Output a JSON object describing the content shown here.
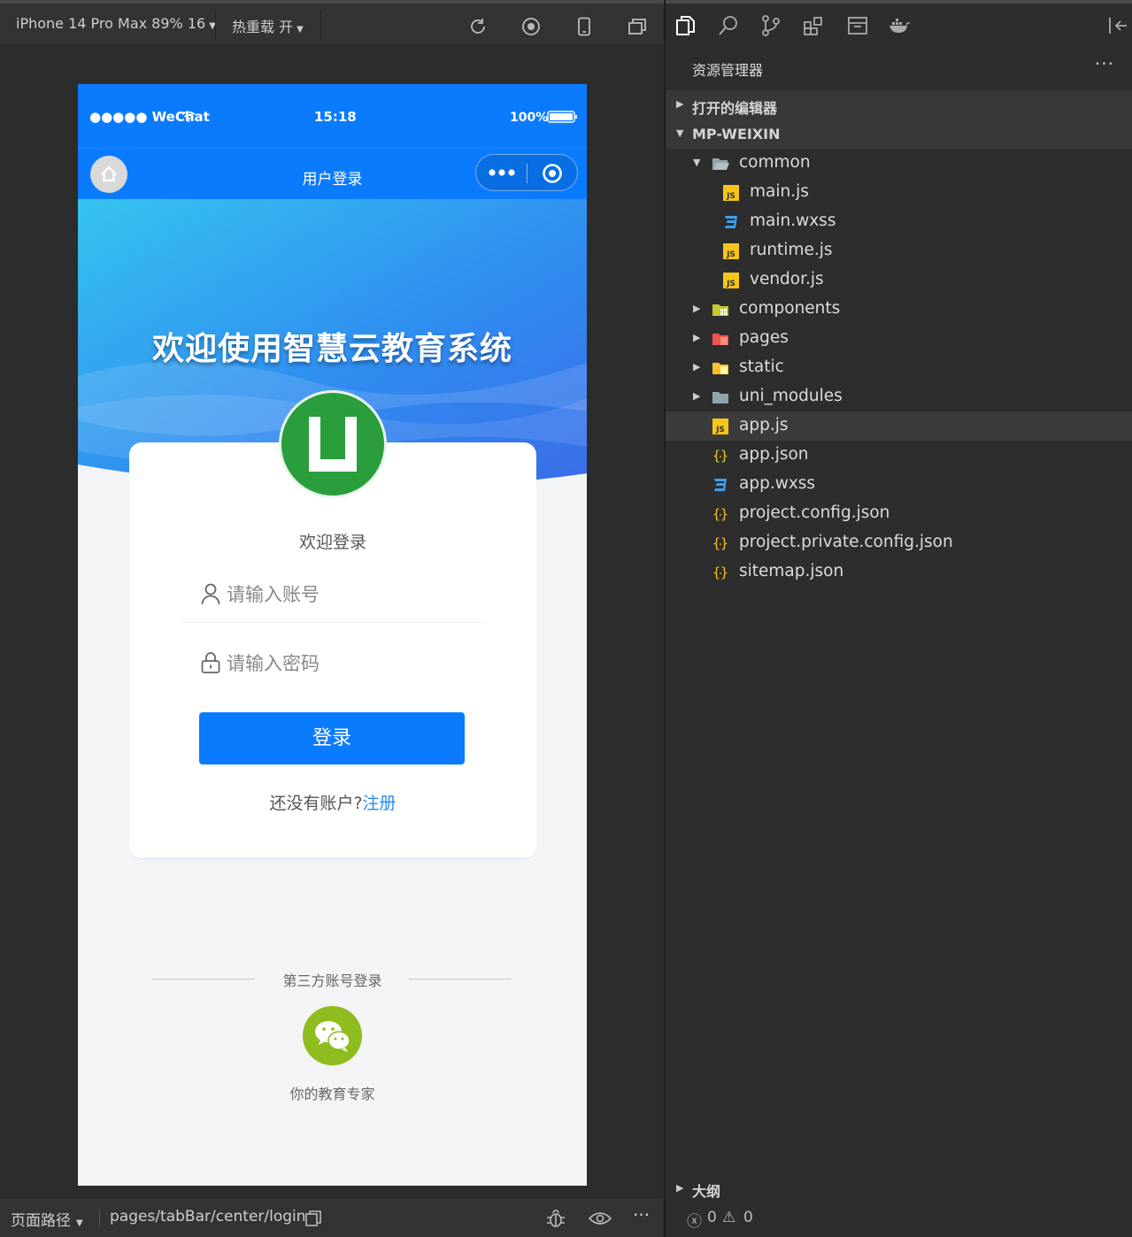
{
  "toolbar": {
    "device": "iPhone 14 Pro Max 89% 16",
    "hot_reload": "热重载 开"
  },
  "phone": {
    "status_left": "●●●●● WeChat",
    "status_time": "15:18",
    "status_battery": "100%",
    "nav_title": "用户登录",
    "hero_title": "欢迎使用智慧云教育系统",
    "welcome": "欢迎登录",
    "account_placeholder": "请输入账号",
    "password_placeholder": "请输入密码",
    "login_button": "登录",
    "register_prompt": "还没有账户?",
    "register_link": "注册",
    "third_party_label": "第三方账号登录",
    "third_party_caption": "你的教育专家"
  },
  "footer": {
    "page_path_label": "页面路径",
    "page_path": "pages/tabBar/center/login"
  },
  "explorer": {
    "title": "资源管理器",
    "more": "···",
    "open_editors": "打开的编辑器",
    "project": "MP-WEIXIN",
    "outline": "大纲",
    "errors": "0",
    "warnings": "0"
  },
  "tree": [
    {
      "name": "common",
      "type": "folder-open",
      "depth": 1,
      "expanded": true
    },
    {
      "name": "main.js",
      "type": "js",
      "depth": 2
    },
    {
      "name": "main.wxss",
      "type": "css",
      "depth": 2
    },
    {
      "name": "runtime.js",
      "type": "js",
      "depth": 2
    },
    {
      "name": "vendor.js",
      "type": "js",
      "depth": 2
    },
    {
      "name": "components",
      "type": "folder-components",
      "depth": 1,
      "expanded": false
    },
    {
      "name": "pages",
      "type": "folder-pages",
      "depth": 1,
      "expanded": false
    },
    {
      "name": "static",
      "type": "folder-static",
      "depth": 1,
      "expanded": false
    },
    {
      "name": "uni_modules",
      "type": "folder",
      "depth": 1,
      "expanded": false
    },
    {
      "name": "app.js",
      "type": "js",
      "depth": 1,
      "selected": true
    },
    {
      "name": "app.json",
      "type": "json",
      "depth": 1
    },
    {
      "name": "app.wxss",
      "type": "css",
      "depth": 1
    },
    {
      "name": "project.config.json",
      "type": "json",
      "depth": 1
    },
    {
      "name": "project.private.config.json",
      "type": "json",
      "depth": 1
    },
    {
      "name": "sitemap.json",
      "type": "json",
      "depth": 1
    }
  ],
  "colors": {
    "wechat_blue": "#0b7bfe",
    "link_blue": "#2a8af4",
    "logo_green": "#2a9d3c",
    "wechat_green": "#8fbc1e"
  }
}
